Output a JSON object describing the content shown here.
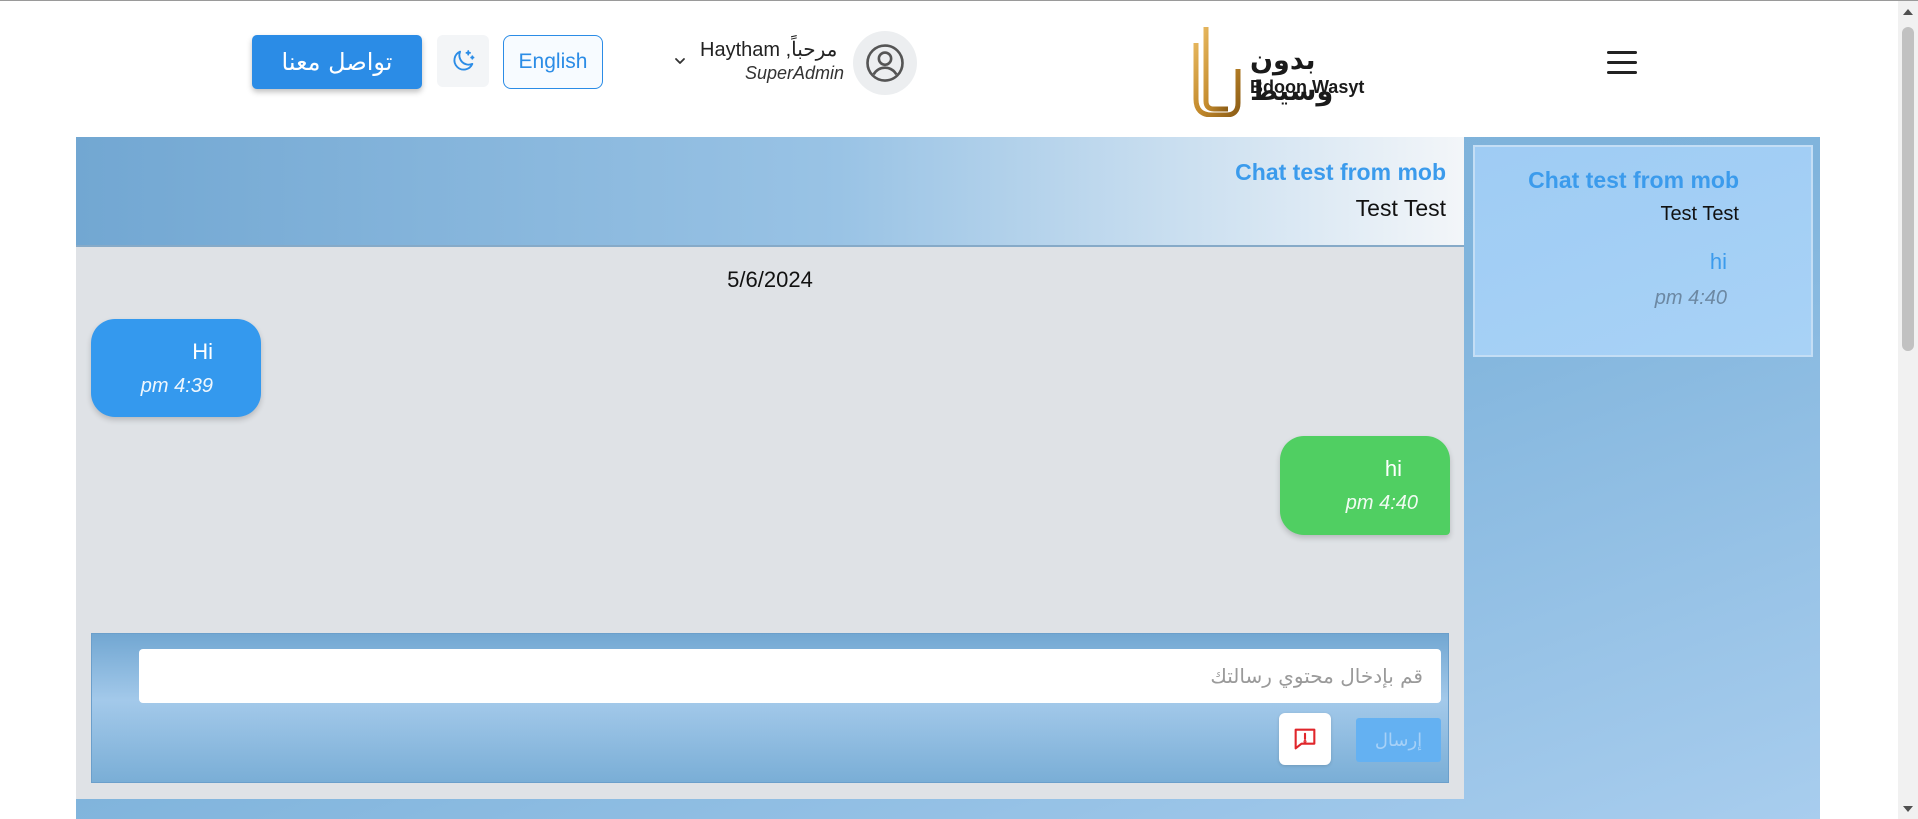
{
  "header": {
    "contact_label": "تواصل معنا",
    "language_label": "English",
    "user": {
      "greeting": "مرحباً, Haytham",
      "role": "SuperAdmin"
    },
    "logo": {
      "arabic": "بدون وسيط",
      "english": "Bdoon Wasyt"
    }
  },
  "chat": {
    "title": "Chat test from mob",
    "subtitle": "Test Test",
    "date": "5/6/2024",
    "messages": [
      {
        "text": "Hi",
        "time": "pm 4:39",
        "direction": "incoming",
        "color": "#3499ee"
      },
      {
        "text": "hi",
        "time": "pm 4:40",
        "direction": "outgoing",
        "color": "#50cf62"
      }
    ],
    "composer": {
      "placeholder": "قم بإدخال محتوي رسالتك",
      "send_label": "إرسال"
    }
  },
  "sidebar": {
    "conversations": [
      {
        "title": "Chat test from mob",
        "subtitle": "Test Test",
        "last_message": "hi",
        "time": "pm 4:40"
      }
    ]
  },
  "colors": {
    "accent": "#2b8ce6",
    "title_blue": "#3b9bec",
    "incoming_bubble": "#3499ee",
    "outgoing_bubble": "#50cf62"
  },
  "icons": {
    "theme": "moon-stars-icon",
    "avatar": "user-circle-icon",
    "menu": "hamburger-menu-icon",
    "report": "chat-alert-icon",
    "chevron": "chevron-down-icon"
  }
}
